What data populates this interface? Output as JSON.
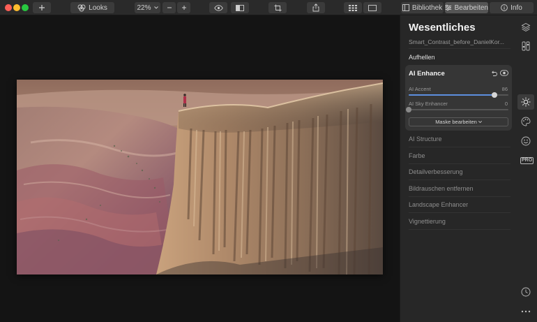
{
  "toolbar": {
    "looks_label": "Looks",
    "zoom_value": "22%",
    "library_label": "Bibliothek",
    "edit_label": "Bearbeiten",
    "info_label": "Info"
  },
  "panel": {
    "title": "Wesentliches",
    "filename": "Smart_Contrast_before_DanielKor...",
    "sections_top": [
      {
        "label": "Aufhellen"
      }
    ],
    "ai_enhance": {
      "title": "AI Enhance",
      "sliders": [
        {
          "label": "AI Accent",
          "value": "86",
          "fraction": 0.86
        },
        {
          "label": "AI Sky Enhancer",
          "value": "0",
          "fraction": 0.0
        }
      ],
      "mask_label": "Maske bearbeiten"
    },
    "sections": [
      {
        "label": "AI Structure"
      },
      {
        "label": "Farbe"
      },
      {
        "label": "Detailverbesserung"
      },
      {
        "label": "Bildrauschen entfernen"
      },
      {
        "label": "Landscape Enhancer"
      },
      {
        "label": "Vignettierung"
      }
    ]
  },
  "iconbar": {
    "pro_label": "PRO",
    "icons": [
      "layers-icon",
      "sliders-panel-icon",
      "sun-icon",
      "palette-icon",
      "smiley-icon",
      "pro-icon",
      "history-clock-icon",
      "more-dots-icon"
    ]
  },
  "colors": {
    "accent": "#5d8fe0",
    "panel_bg": "#272727",
    "card_bg": "#363636",
    "canvas_bg": "#141414"
  }
}
